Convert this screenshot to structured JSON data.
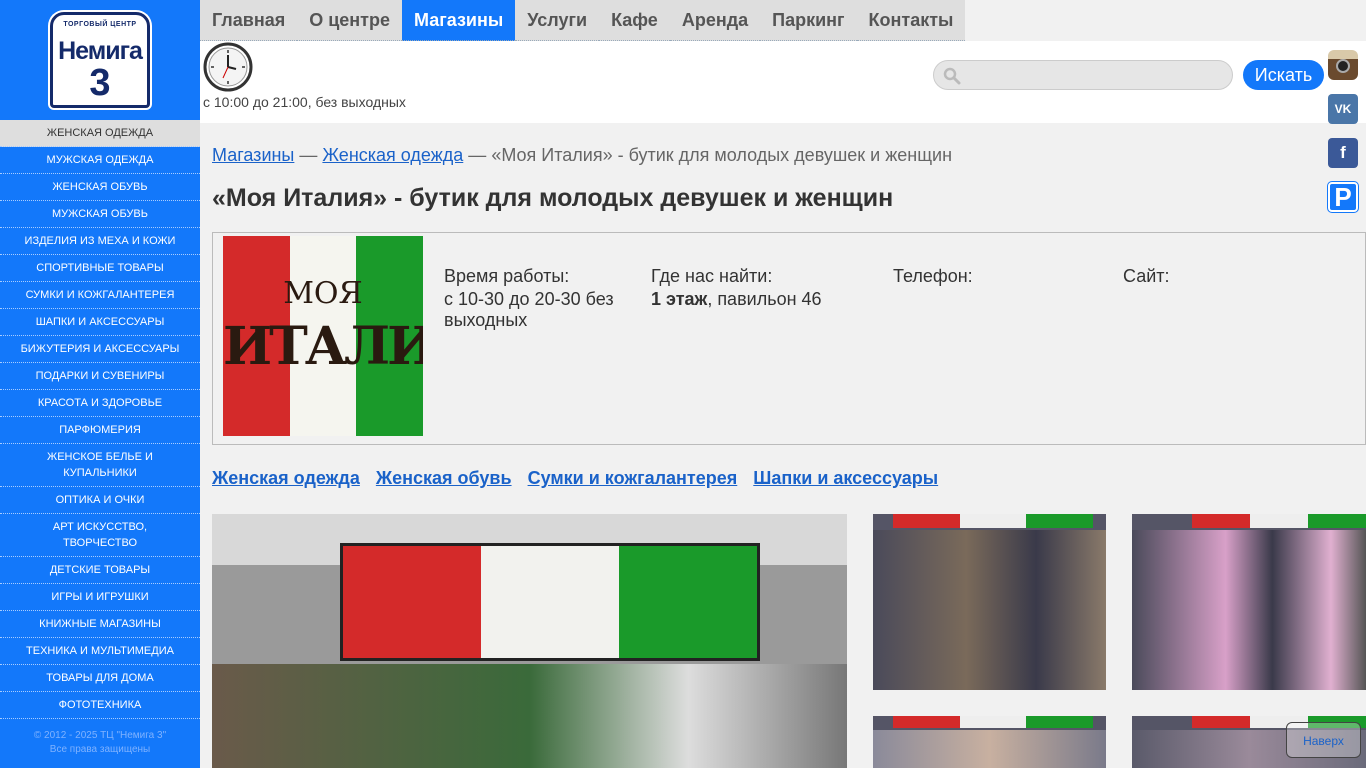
{
  "logo": {
    "arc_text": "ТОРГОВЫЙ ЦЕНТР",
    "name": "Немига",
    "number": "3"
  },
  "sidebar": {
    "items": [
      {
        "label": "Женская одежда"
      },
      {
        "label": "Мужская одежда"
      },
      {
        "label": "Женская обувь"
      },
      {
        "label": "Мужская обувь"
      },
      {
        "label": "Изделия из меха и кожи"
      },
      {
        "label": "Спортивные товары"
      },
      {
        "label": "Сумки и кожгалантерея"
      },
      {
        "label": "Шапки и аксессуары"
      },
      {
        "label": "Бижутерия и аксессуары"
      },
      {
        "label": "Подарки и сувениры"
      },
      {
        "label": "Красота и здоровье"
      },
      {
        "label": "Парфюмерия"
      },
      {
        "label": "Женское белье и купальники"
      },
      {
        "label": "Оптика и очки"
      },
      {
        "label": "Арт искусство, творчество"
      },
      {
        "label": "Детские товары"
      },
      {
        "label": "Игры и игрушки"
      },
      {
        "label": "Книжные магазины"
      },
      {
        "label": "Техника и мультимедиа"
      },
      {
        "label": "Товары для дома"
      },
      {
        "label": "Фототехника"
      }
    ],
    "copyright_line1": "© 2012 - 2025 ТЦ \"Немига 3\"",
    "copyright_line2": "Все права защищены"
  },
  "nav": {
    "items": [
      {
        "label": "Главная"
      },
      {
        "label": "О центре"
      },
      {
        "label": "Магазины"
      },
      {
        "label": "Услуги"
      },
      {
        "label": "Кафе"
      },
      {
        "label": "Аренда"
      },
      {
        "label": "Паркинг"
      },
      {
        "label": "Контакты"
      }
    ]
  },
  "header": {
    "hours": "с 10:00 до 21:00, без выходных",
    "search_placeholder": "",
    "search_button": "Искать"
  },
  "social": {
    "vk": "VK",
    "facebook": "f",
    "parking": "P"
  },
  "breadcrumb": {
    "root": "Магазины",
    "separator": "—",
    "category": "Женская одежда",
    "current": "«Моя Италия» - бутик для молодых девушек и женщин"
  },
  "title": "«Моя Италия» - бутик для молодых девушек и женщин",
  "shop": {
    "logo_line1": "МОЯ",
    "logo_line2": "ИТАЛИЯ",
    "hours_label": "Время работы:",
    "hours_value": "с 10-30 до 20-30 без выходных",
    "location_label": "Где нас найти:",
    "location_floor": "1 этаж",
    "location_rest": ", павильон 46",
    "phone_label": "Телефон:",
    "site_label": "Сайт:"
  },
  "category_links": [
    {
      "label": "Женская одежда"
    },
    {
      "label": "Женская обувь"
    },
    {
      "label": "Сумки и кожгалантерея"
    },
    {
      "label": "Шапки и аксессуары"
    }
  ],
  "scroll_up": "Наверх",
  "colors": {
    "accent": "#1378fa",
    "italy_red": "#d42a2a",
    "italy_green": "#1a9a2a"
  }
}
